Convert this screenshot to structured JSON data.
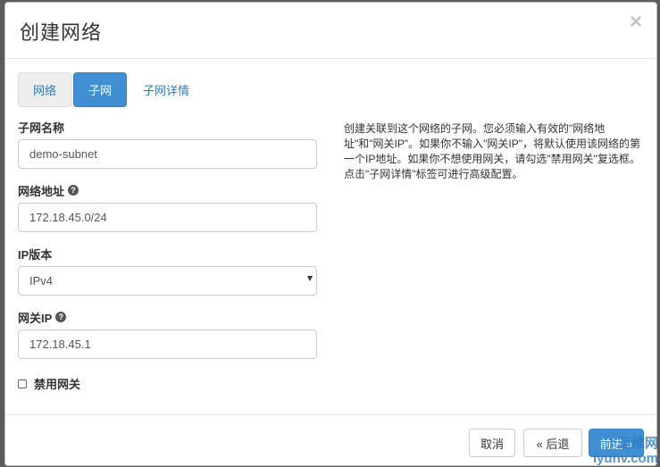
{
  "dialog": {
    "title": "创建网络",
    "close": "×"
  },
  "tabs": [
    {
      "label": "网络"
    },
    {
      "label": "子网"
    },
    {
      "label": "子网详情"
    }
  ],
  "form": {
    "subnet_name": {
      "label": "子网名称",
      "value": "demo-subnet"
    },
    "network_address": {
      "label": "网络地址",
      "value": "172.18.45.0/24",
      "help": "?"
    },
    "ip_version": {
      "label": "IP版本",
      "selected": "IPv4"
    },
    "gateway_ip": {
      "label": "网关IP",
      "value": "172.18.45.1",
      "help": "?"
    },
    "disable_gateway": {
      "label": "禁用网关",
      "checked": false
    }
  },
  "help_text": "创建关联到这个网络的子网。您必须输入有效的\"网络地址\"和\"网关IP\"。如果你不输入\"网关IP\"，将默认使用该网络的第一个IP地址。如果你不想使用网关，请勾选\"禁用网关\"复选框。点击\"子网详情\"标签可进行高级配置。",
  "footer": {
    "cancel": "取消",
    "back": "« 后退",
    "next": "前进 »"
  },
  "watermark": {
    "line1": "运维网",
    "line2": "iyunv.com"
  },
  "colors": {
    "primary": "#3f8fd2",
    "link": "#337ab7"
  }
}
